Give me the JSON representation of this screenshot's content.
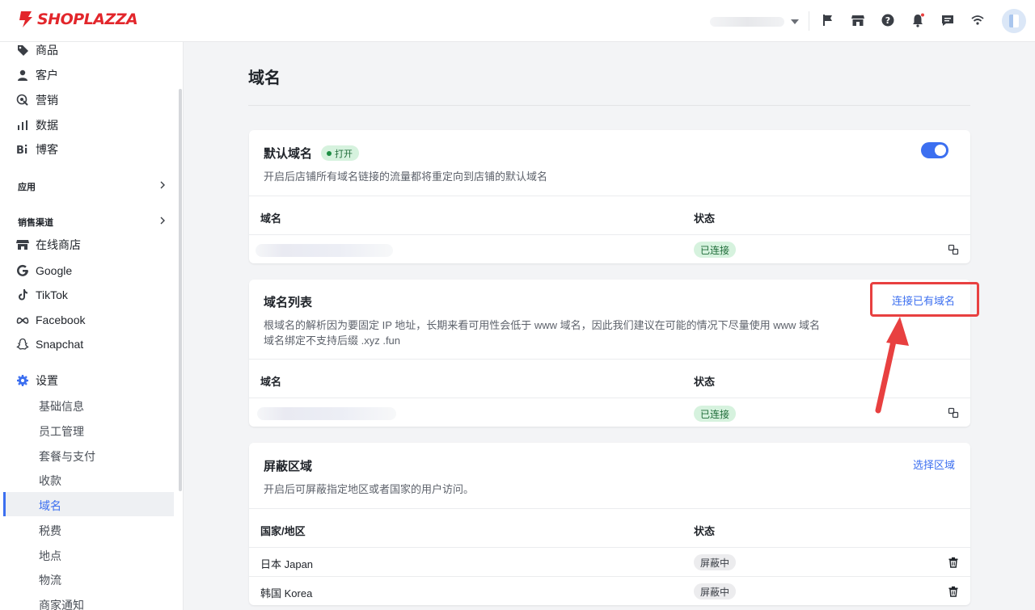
{
  "brand": {
    "name": "SHOPLAZZA",
    "color": "#e2262b"
  },
  "accent": "#3c6ff0",
  "topbar": {
    "icons": [
      "flag-icon",
      "store-icon",
      "help-icon",
      "bell-icon",
      "message-icon",
      "wifi-icon"
    ]
  },
  "sidebar": {
    "items_top": [
      {
        "label": "商品",
        "icon": "tag-icon"
      },
      {
        "label": "客户",
        "icon": "person-icon"
      },
      {
        "label": "营销",
        "icon": "marketing-icon"
      },
      {
        "label": "数据",
        "icon": "chart-icon"
      },
      {
        "label": "博客",
        "icon": "blog-icon"
      }
    ],
    "group_apps": "应用",
    "group_channels": "销售渠道",
    "channels": [
      {
        "label": "在线商店",
        "icon": "store-icon"
      },
      {
        "label": "Google",
        "icon": "google-icon"
      },
      {
        "label": "TikTok",
        "icon": "tiktok-icon"
      },
      {
        "label": "Facebook",
        "icon": "meta-icon"
      },
      {
        "label": "Snapchat",
        "icon": "snapchat-icon"
      }
    ],
    "settings": "设置",
    "settings_sub": [
      "基础信息",
      "员工管理",
      "套餐与支付",
      "收款",
      "域名",
      "税费",
      "地点",
      "物流",
      "商家通知"
    ],
    "active": "域名"
  },
  "main": {
    "title": "域名",
    "default_domain": {
      "title": "默认域名",
      "badge": "打开",
      "toggle_on": true,
      "desc": "开启后店铺所有域名链接的流量都将重定向到店铺的默认域名",
      "col_domain": "域名",
      "col_status": "状态",
      "status": "已连接"
    },
    "domain_list": {
      "title": "域名列表",
      "action": "连接已有域名",
      "desc1": "根域名的解析因为要固定 IP 地址，长期来看可用性会低于 www 域名，因此我们建议在可能的情况下尽量使用 www 域名",
      "desc2": "域名绑定不支持后缀 .xyz .fun",
      "col_domain": "域名",
      "col_status": "状态",
      "status": "已连接"
    },
    "block_region": {
      "title": "屏蔽区域",
      "action": "选择区域",
      "desc": "开启后可屏蔽指定地区或者国家的用户访问。",
      "col_region": "国家/地区",
      "col_status": "状态",
      "rows": [
        {
          "region": "日本 Japan",
          "status": "屏蔽中"
        },
        {
          "region": "韩国 Korea",
          "status": "屏蔽中"
        }
      ]
    }
  }
}
